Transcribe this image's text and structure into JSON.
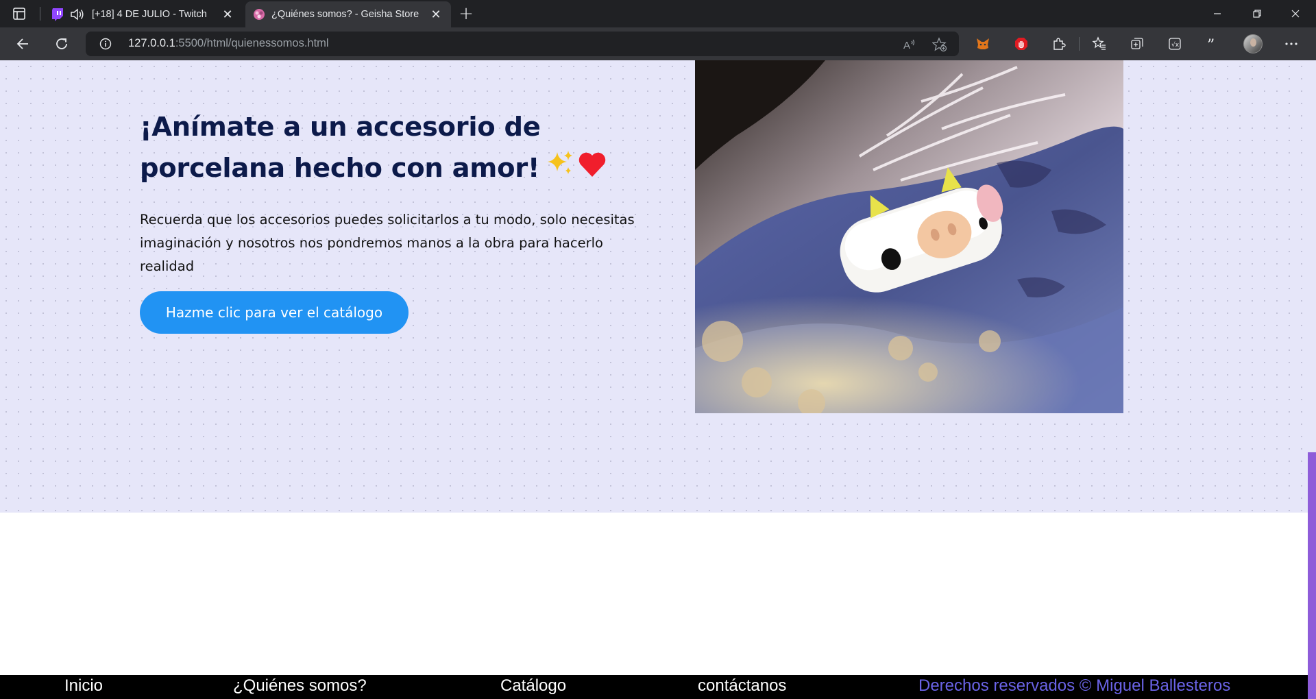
{
  "browser": {
    "tabs": [
      {
        "title": "[+18] 4 DE JULIO - Twitch",
        "favicon": "twitch-icon",
        "audio": true,
        "active": false
      },
      {
        "title": "¿Quiénes somos? - Geisha Store",
        "favicon": "geisha-store-icon",
        "active": true
      }
    ],
    "url_host": "127.0.0.1",
    "url_rest": ":5500/html/quienessomos.html",
    "toolbar_icons": [
      "read-aloud-icon",
      "add-favorite-icon",
      "metamask-icon",
      "adblock-icon",
      "extensions-icon",
      "favorites-icon",
      "collections-icon",
      "math-solver-icon",
      "citations-icon",
      "profile-avatar",
      "more-menu-icon"
    ]
  },
  "hero": {
    "title": "¡Anímate a un accesorio de porcelana hecho con amor!",
    "title_emoji_1": "✨",
    "title_emoji_2": "❤️",
    "description": "Recuerda que los accesorios puedes solicitarlos a tu modo, solo necesitas imaginación y nosotros nos pondremos manos a la obra para hacerlo realidad",
    "cta_label": "Hazme clic para ver el catálogo"
  },
  "footer": {
    "links": [
      "Inicio",
      "¿Quiénes somos?",
      "Catálogo",
      "contáctanos"
    ],
    "copyright": "Derechos reservados © Miguel Ballesteros"
  },
  "colors": {
    "hero_bg": "#e6e6f9",
    "title": "#0c1a4a",
    "cta": "#2193f3",
    "footer_bg": "#000000",
    "copyright": "#6a63e6",
    "scrollbar": "#8e5cd9"
  }
}
